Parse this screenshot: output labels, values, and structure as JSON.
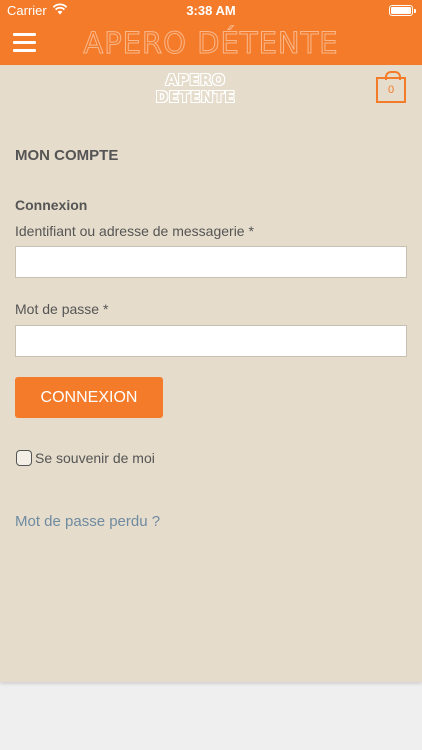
{
  "status_bar": {
    "carrier": "Carrier",
    "time": "3:38 AM"
  },
  "nav": {
    "title": "APERO DÉTENTE"
  },
  "header": {
    "logo_line1": "APERO",
    "logo_line2": "DETENTE",
    "cart_count": "0"
  },
  "account": {
    "title": "MON COMPTE",
    "login_heading": "Connexion",
    "username_label": "Identifiant ou adresse de messagerie *",
    "username_value": "",
    "password_label": "Mot de passe *",
    "password_value": "",
    "login_button": "CONNEXION",
    "remember_label": "Se souvenir de moi",
    "lost_password_link": "Mot de passe perdu ?"
  },
  "colors": {
    "brand": "#f47b2a",
    "background": "#e5dccb",
    "link": "#6f8ba1"
  }
}
